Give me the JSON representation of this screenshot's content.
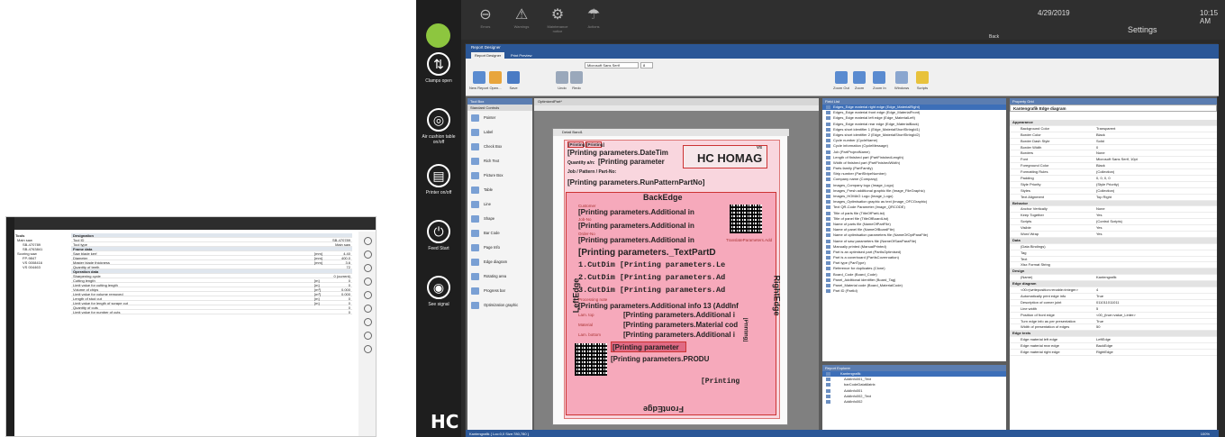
{
  "small": {
    "tree": [
      "Main saw",
      "SB-470789",
      "SB-4763841",
      "Scoring saw",
      "FP-9847",
      "VS 0008416",
      "VS 004463"
    ],
    "header": {
      "tools": "Tools",
      "designation": "Designation"
    },
    "rows": [
      {
        "k": "Tool ID",
        "u": "",
        "v": "SB-470789"
      },
      {
        "k": "Tool type",
        "u": "",
        "v": "Main saw"
      },
      {
        "k": "Frame data",
        "u": "",
        "v": "",
        "hdr": true
      },
      {
        "k": "Saw blade kerf",
        "u": "[mm]",
        "v": "4.40"
      },
      {
        "k": "Diameter",
        "u": "[mm]",
        "v": "400.0"
      },
      {
        "k": "Master blade thickness",
        "u": "[mm]",
        "v": "3.6"
      },
      {
        "k": "Quantity of teeth",
        "u": "",
        "v": "72"
      },
      {
        "k": "Operation data",
        "u": "",
        "v": "",
        "hdr": true
      },
      {
        "k": "Sharpening cycle",
        "u": "",
        "v": "0 (current)"
      },
      {
        "k": "Cutting length",
        "u": "[m]",
        "v": "0"
      },
      {
        "k": "Limit value for cutting length",
        "u": "[m]",
        "v": "0"
      },
      {
        "k": "Volume of chips",
        "u": "[m³]",
        "v": "0.000"
      },
      {
        "k": "Limit value for volume removed",
        "u": "[m³]",
        "v": "0.000"
      },
      {
        "k": "Length of stud cut",
        "u": "[m]",
        "v": "0"
      },
      {
        "k": "Limit value for length of scrape cut",
        "u": "[m]",
        "v": "0"
      },
      {
        "k": "Quantity of cuts",
        "u": "",
        "v": "0"
      },
      {
        "k": "Limit value for number of cuts",
        "u": "",
        "v": "0"
      }
    ]
  },
  "top": {
    "date": "4/29/2019",
    "time": "10:15 AM",
    "settings": "Settings",
    "back": "Back"
  },
  "topicons": [
    {
      "glyph": "⊖",
      "label": "Errors"
    },
    {
      "glyph": "⚠",
      "label": "Warnings"
    },
    {
      "glyph": "⚙",
      "label": "Maintenance notice"
    },
    {
      "glyph": "☂",
      "label": "Actions"
    }
  ],
  "leftbar": [
    {
      "glyph": "⇅",
      "label": "Clamps open"
    },
    {
      "glyph": "◎",
      "label": "Air cushion table on/off"
    },
    {
      "glyph": "▤",
      "label": "Printer on/off"
    },
    {
      "glyph": "⏻",
      "label": "Feed Start"
    },
    {
      "glyph": "◉",
      "label": "See signal"
    }
  ],
  "rd": {
    "title": "Report Designer",
    "tabs": [
      "Report Designer",
      "Print Preview"
    ],
    "ribbon": [
      {
        "label": "New Report",
        "c": "#5a8bd0"
      },
      {
        "label": "Open...",
        "c": "#e8a53c"
      },
      {
        "label": "Save",
        "c": "#4a7bc4"
      },
      {
        "label": "Undo",
        "c": "#9aa8bb"
      },
      {
        "label": "Redo",
        "c": "#9aa8bb"
      },
      {
        "label": "Zoom Out",
        "c": "#5a8bd0"
      },
      {
        "label": "Zoom",
        "c": "#5a8bd0"
      },
      {
        "label": "Zoom In",
        "c": "#5a8bd0"
      },
      {
        "label": "Windows",
        "c": "#8aa6cf"
      },
      {
        "label": "Scripts",
        "c": "#e8c23c"
      }
    ],
    "font": "Microsoft Sans Serif",
    "fontsize": "8",
    "toolbox_title": "Tool Box",
    "toolbox_cat": "Standard Controls",
    "toolbox": [
      "Pointer",
      "Label",
      "Check Box",
      "Rich Text",
      "Picture Box",
      "Table",
      "Line",
      "Shape",
      "Bar Code",
      "Page Info",
      "Edge diagram",
      "Rotating area",
      "Progress bar",
      "Optimization graphic"
    ],
    "canvas_tab": "OptimizedPart*",
    "detail": "Detail Band1",
    "fieldlist_title": "Field List",
    "fields": [
      "Edges_Edge material right edge (Edge_MaterialRight)",
      "Edges_Edge material front edge (Edge_MaterialFront)",
      "Edges_Edge material left edge (Edge_MaterialLeft)",
      "Edges_Edge material rear edge (Edge_MaterialBack)",
      "Edges short identifier 1 (Edge_MaterialShortStringId1)",
      "Edges short identifier 2 (Edge_MaterialShortStringId2)",
      "Cycle number (CycleName)",
      "Cycle information (CycleMessage)",
      "Job (PartProjectName)",
      "Length of finished part (PartFinishedLength)",
      "Width of finished part (PartFinishedWidth)",
      "Parts family (PartFamily)",
      "Strip number (PartStripeNumber)",
      "Company name (Company)",
      "Images_Company logo (Image_Logo)",
      "Images_Fresh additional graphic file (Image_FileGraphic)",
      "Images_HOMAG Logo (Image_Logo)",
      "Images_Optimisation graphic as text (Image_OFCGraphic)",
      "Text QR-Code Parameter (Image_QRCODE)",
      "Title of parts file (TitleOfPartList)",
      "Title of panel file (TitleOfBoardList)",
      "Name of parts file (NameOfPartFile)",
      "Name of panel file (NameOfBoardFile)",
      "Name of optimisation parameters file (NameOfOptParaFile)",
      "Name of saw parameters file (NameOfSawParaFile)",
      "Manually printed (ManualPrinted)",
      "Part is an optimised part (PartIsOptimised)",
      "Part is a coverboard (PartIsCoverroation)",
      "Part type (PartType)",
      "Reference for duplicates (Clone)",
      "Board_Code (Board_Code)",
      "Panel_Additional identifier (Board_Tag)",
      "Panel_Material code (Board_MaterialCode)",
      "Part ID (PartId)"
    ],
    "explorer_title": "Report Explorer",
    "explorer": [
      "Kantengrafik",
      "AddInfo001_Text",
      "barCodeDataMatrix",
      "AddInfo001",
      "AddInfo002_Text",
      "AddInfo002"
    ],
    "propgrid_title": "Property Grid",
    "prop_object": "Kantengrafik  Edge diagram",
    "props": [
      {
        "k": "Appearance",
        "cat": true
      },
      {
        "k": "Background Color",
        "v": "Transparent"
      },
      {
        "k": "Border Color",
        "v": "Black"
      },
      {
        "k": "Border Dash Style",
        "v": "Solid"
      },
      {
        "k": "Border Width",
        "v": "0"
      },
      {
        "k": "Borders",
        "v": "None"
      },
      {
        "k": "Font",
        "v": "Microsoft Sans Serif, 10pt"
      },
      {
        "k": "Foreground Color",
        "v": "Black"
      },
      {
        "k": "Formatting Rules",
        "v": "(Collection)"
      },
      {
        "k": "Padding",
        "v": "0, 0, 0, 0"
      },
      {
        "k": "Style Priority",
        "v": "(Style Priority)"
      },
      {
        "k": "Styles",
        "v": "(Collection)"
      },
      {
        "k": "Text Alignment",
        "v": "Top Right"
      },
      {
        "k": "Behavior",
        "cat": true
      },
      {
        "k": "Anchor Vertically",
        "v": "None"
      },
      {
        "k": "Keep Together",
        "v": "Yes"
      },
      {
        "k": "Scripts",
        "v": "(Control Scripts)"
      },
      {
        "k": "Visible",
        "v": "Yes"
      },
      {
        "k": "Word Wrap",
        "v": "Yes"
      },
      {
        "k": "Data",
        "cat": true
      },
      {
        "k": "(Data Bindings)",
        "v": ""
      },
      {
        "k": "Tag",
        "v": ""
      },
      {
        "k": "Text",
        "v": ""
      },
      {
        "k": "Xlsx Format String",
        "v": ""
      },
      {
        "k": "Design",
        "cat": true
      },
      {
        "k": "(Name)",
        "v": "Kantengrafik"
      },
      {
        "k": "Edge diagram",
        "cat": true
      },
      {
        "k": "<00>(writeposition>enable>integer>",
        "v": "4"
      },
      {
        "k": "Automatically print edge info",
        "v": "True"
      },
      {
        "k": "Description of corner joint",
        "v": "011011011011"
      },
      {
        "k": "Line width",
        "v": "5"
      },
      {
        "k": "Position of front edge",
        "v": "<00_(true>value_Linter>"
      },
      {
        "k": "Turn edge info as per presentation",
        "v": "True"
      },
      {
        "k": "Width of presentation of edges",
        "v": "50"
      },
      {
        "k": "Edge texts",
        "cat": true
      },
      {
        "k": "Edge material left edge",
        "v": "LeftEdge"
      },
      {
        "k": "Edge material rear edge",
        "v": "BackEdge"
      },
      {
        "k": "Edge material right edge",
        "v": "RightEdge"
      }
    ],
    "status": "Kantengrafik { Loc:0,0 Size:780,780 }",
    "zoom": "100%"
  },
  "report": {
    "printing_a": "[Printing]",
    "printing_b": "[Printing]",
    "date": "[Printing parameters.DateTim",
    "vs": "VS",
    "homag": "HC HOMAG",
    "quantity": "Quantity a/n:",
    "param": "[Printing parameter",
    "job": "Job / Pattern / Part-No:",
    "runpattern": "[Printing parameters.RunPatternPartNo]",
    "back": "BackEdge",
    "front": "FrontEdge",
    "left": "LeftEdge",
    "right": "RightEdge",
    "customer": "Customer",
    "add1": "[Printing parameters.Additional in",
    "jobno": "Job-No",
    "add2": "[Printing parameters.Additional in",
    "orderno": "Order-No",
    "add3": "[Printing parameters.Additional in",
    "transl": "TranslateParameters.Add",
    "textpart": "[Printing parameters._TextPartD",
    "cut1": "1.CutDim [Printing parameters.Le",
    "cut2": "2.CutDim [Printing parameters.Ad",
    "cut3": "3.CutDim [Printing parameters.Ad",
    "procnote": "Processing note",
    "add13": "[Printing parameters.Additional info 13 (AddInf",
    "lamtop": "Lam. top",
    "addi": "[Printing parameters.Additional i",
    "material": "Material",
    "matcod": "[Printing parameters.Material cod",
    "lambottom": "Lam. bottom",
    "addi2": "[Printing parameters.Additional i",
    "param2": "[Printing parameter",
    "produ": "[Printing parameters.PRODU",
    "printing_c": "[Printing",
    "vert": "[Printing]"
  }
}
